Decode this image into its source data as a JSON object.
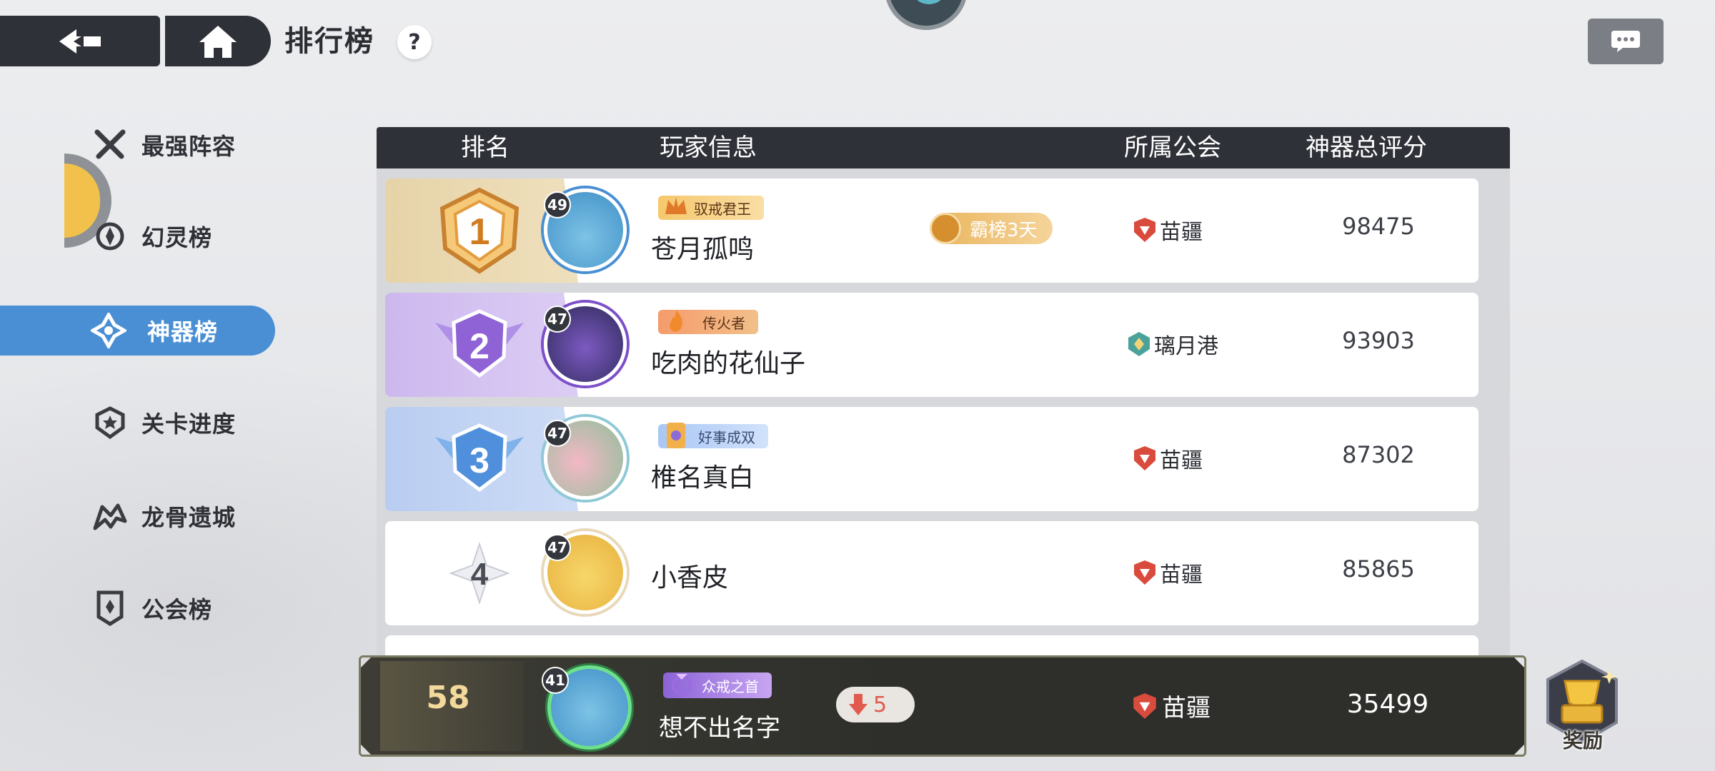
{
  "header": {
    "title": "排行榜",
    "help": "?"
  },
  "sidebar": {
    "items": [
      {
        "label": "最强阵容",
        "icon": "crossed-swords-icon"
      },
      {
        "label": "幻灵榜",
        "icon": "spirit-icon"
      },
      {
        "label": "神器榜",
        "icon": "artifact-icon",
        "active": true
      },
      {
        "label": "关卡进度",
        "icon": "star-shield-icon"
      },
      {
        "label": "龙骨遗城",
        "icon": "dragon-icon"
      },
      {
        "label": "公会榜",
        "icon": "banner-icon"
      }
    ]
  },
  "table": {
    "headers": {
      "rank": "排名",
      "player": "玩家信息",
      "guild": "所属公会",
      "score": "神器总评分"
    },
    "rows": [
      {
        "rank": "1",
        "level": "49",
        "title": "驭戒君王",
        "name": "苍月孤鸣",
        "streak": "霸榜3天",
        "guild": "苗疆",
        "score": "98475"
      },
      {
        "rank": "2",
        "level": "47",
        "title": "传火者",
        "name": "吃肉的花仙子",
        "guild": "璃月港",
        "score": "93903"
      },
      {
        "rank": "3",
        "level": "47",
        "title": "好事成双",
        "name": "椎名真白",
        "guild": "苗疆",
        "score": "87302"
      },
      {
        "rank": "4",
        "level": "47",
        "name": "小香皮",
        "guild": "苗疆",
        "score": "85865"
      }
    ]
  },
  "self": {
    "rank": "58",
    "level": "41",
    "title": "众戒之首",
    "name": "想不出名字",
    "change": "5",
    "change_direction": "down",
    "guild": "苗疆",
    "score": "35499"
  },
  "reward": {
    "label": "奖励"
  },
  "colors": {
    "dark": "#2f3138",
    "accent_blue": "#4a8fd4",
    "gold": "#e9b55d",
    "purple": "#b99be6",
    "light_blue": "#a9c3ee"
  }
}
